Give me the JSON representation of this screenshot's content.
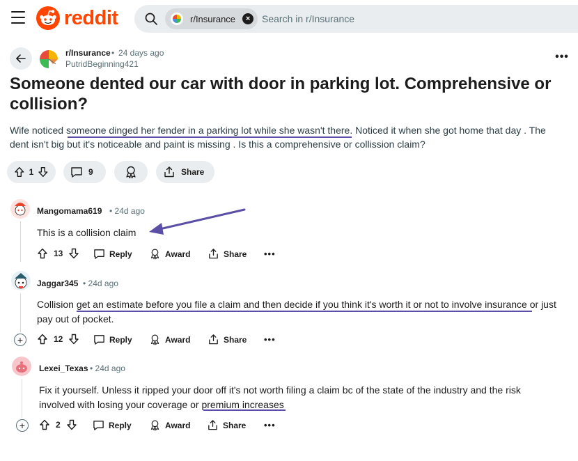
{
  "header": {
    "logo_text": "reddit",
    "search_chip_label": "r/Insurance",
    "search_placeholder": "Search in r/Insurance"
  },
  "post": {
    "subreddit": "r/Insurance",
    "separator": "•",
    "time": "24 days ago",
    "author": "PutridBeginning421",
    "title": "Someone dented our car with door in parking lot. Comprehensive or collision?",
    "body_prefix": "Wife noticed ",
    "body_highlight": "someone dinged her fender in a parking lot while she wasn't there",
    "body_suffix": ". Noticed it when she got home that day . The dent isn't big but it's noticeable and paint is missing . Is this a comprehensive or collission claim?",
    "upvotes": "1",
    "comments": "9",
    "share_label": "Share"
  },
  "comments": [
    {
      "author": "Mangomama619",
      "time": "• 24d ago",
      "text": "This is a collision claim",
      "votes": "13",
      "reply": "Reply",
      "award": "Award",
      "share": "Share"
    },
    {
      "author": "Jaggar345",
      "time": "• 24d ago",
      "text_prefix": "Collision ",
      "text_highlight": "get an estimate before you file a claim and then decide if you think it's worth it or not to involve insurance",
      "text_suffix": " or just pay out of pocket.",
      "votes": "12",
      "reply": "Reply",
      "award": "Award",
      "share": "Share"
    },
    {
      "author": "Lexei_Texas",
      "time": "• 24d ago",
      "text_prefix": "Fix it yourself. Unless it ripped your door off it's not worth filing a claim bc of the state of the industry and the risk involved with losing your coverage or ",
      "text_highlight": "premium increases",
      "votes": "2",
      "reply": "Reply",
      "award": "Award",
      "share": "Share"
    }
  ],
  "colors": {
    "brand": "#ff4500",
    "annotation": "#5b4ea6",
    "pill_bg": "#eaedef",
    "meta_text": "#576f76"
  }
}
